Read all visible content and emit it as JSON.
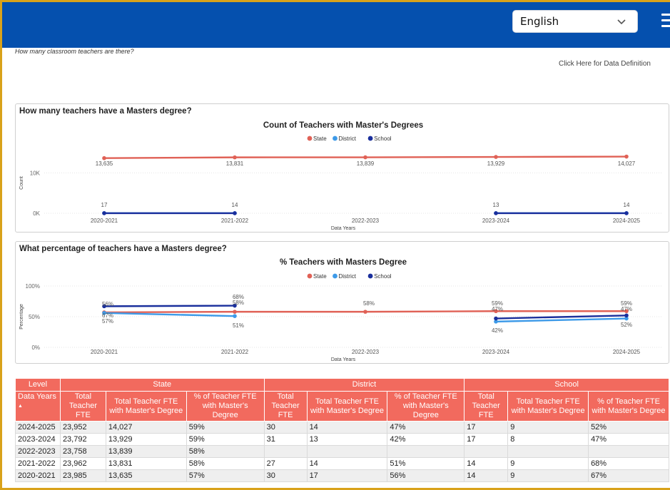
{
  "header": {
    "language": "English",
    "question": "How many classroom teachers are there?",
    "data_definition_link": "Click Here for Data Definition"
  },
  "colors": {
    "state": "#e06156",
    "district": "#3d9ae8",
    "school": "#1a2f9c",
    "header_bg": "#0550ae",
    "table_header": "#f26a5e"
  },
  "chart_data": [
    {
      "type": "line",
      "section_title": "How many teachers have a Masters degree?",
      "title": "Count of Teachers with Master's Degrees",
      "legend": [
        "State",
        "District",
        "School"
      ],
      "legend_placement": "top-center",
      "xlabel": "Data Years",
      "ylabel": "Count",
      "categories": [
        "2020-2021",
        "2021-2022",
        "2022-2023",
        "2023-2024",
        "2024-2025"
      ],
      "yticks": [
        {
          "v": 0,
          "label": "0K"
        },
        {
          "v": 10000,
          "label": "10K"
        }
      ],
      "ylim": [
        0,
        15000
      ],
      "series": [
        {
          "name": "State",
          "values": [
            13635,
            13831,
            13839,
            13929,
            14027
          ],
          "labels": [
            "13,635",
            "13,831",
            "13,839",
            "13,929",
            "14,027"
          ]
        },
        {
          "name": "District",
          "values": [
            30,
            27,
            null,
            31,
            30
          ],
          "labels": []
        },
        {
          "name": "School",
          "values": [
            17,
            14,
            null,
            13,
            14
          ],
          "labels": [
            "17",
            "14",
            "",
            "13",
            "14"
          ]
        }
      ],
      "grid": true
    },
    {
      "type": "line",
      "section_title": "What percentage of teachers have a Masters degree?",
      "title": "% Teachers with Masters Degree",
      "legend": [
        "State",
        "District",
        "School"
      ],
      "legend_placement": "top-center",
      "xlabel": "Data Years",
      "ylabel": "Percentage",
      "categories": [
        "2020-2021",
        "2021-2022",
        "2022-2023",
        "2023-2024",
        "2024-2025"
      ],
      "yticks": [
        {
          "v": 0,
          "label": "0%"
        },
        {
          "v": 50,
          "label": "50%"
        },
        {
          "v": 100,
          "label": "100%"
        }
      ],
      "ylim": [
        0,
        100
      ],
      "series": [
        {
          "name": "State",
          "values": [
            57,
            58,
            58,
            59,
            59
          ],
          "labels": [
            "57%",
            "58%",
            "58%",
            "59%",
            "59%"
          ]
        },
        {
          "name": "District",
          "values": [
            56,
            51,
            null,
            42,
            47
          ],
          "labels": [
            "",
            "51%",
            "",
            "42%",
            "47%"
          ]
        },
        {
          "name": "School",
          "values": [
            67,
            68,
            null,
            47,
            52
          ],
          "labels": [
            "67%",
            "68%",
            "",
            "47%",
            "52%"
          ]
        }
      ],
      "extra_labels": [
        [
          "56%"
        ],
        [
          "58%"
        ],
        [],
        [
          "47%"
        ],
        [
          "52%"
        ]
      ],
      "grid": true
    }
  ],
  "table": {
    "level_label": "Level",
    "groups": [
      "State",
      "District",
      "School"
    ],
    "data_years_label": "Data Years",
    "sort_indicator": "▲",
    "sub_headers": [
      "Total Teacher FTE",
      "Total Teacher FTE with Master's Degree",
      "% of Teacher FTE with Master's Degree"
    ],
    "rows": [
      [
        "2024-2025",
        "23,952",
        "14,027",
        "59%",
        "30",
        "14",
        "47%",
        "17",
        "9",
        "52%"
      ],
      [
        "2023-2024",
        "23,792",
        "13,929",
        "59%",
        "31",
        "13",
        "42%",
        "17",
        "8",
        "47%"
      ],
      [
        "2022-2023",
        "23,758",
        "13,839",
        "58%",
        "",
        "",
        "",
        "",
        "",
        ""
      ],
      [
        "2021-2022",
        "23,962",
        "13,831",
        "58%",
        "27",
        "14",
        "51%",
        "14",
        "9",
        "68%"
      ],
      [
        "2020-2021",
        "23,985",
        "13,635",
        "57%",
        "30",
        "17",
        "56%",
        "14",
        "9",
        "67%"
      ]
    ]
  }
}
